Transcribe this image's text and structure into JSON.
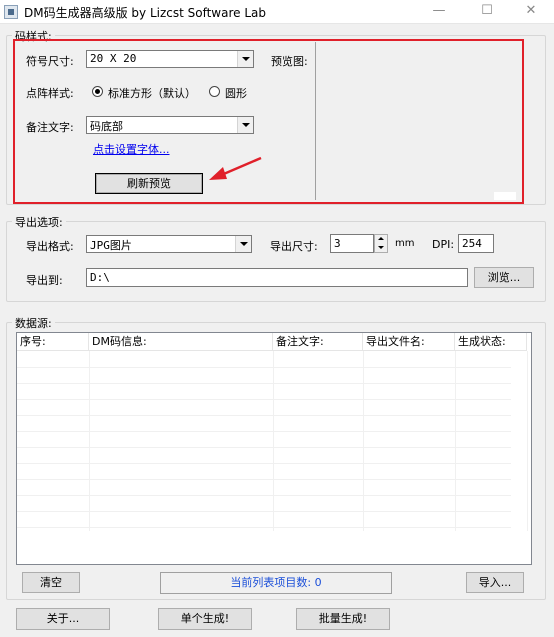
{
  "window": {
    "title": "DM码生成器高级版   by Lizcst Software Lab",
    "minimize_glyph": "—",
    "maximize_glyph": "☐",
    "close_glyph": "✕"
  },
  "style_group": {
    "label": "码样式:",
    "symbol_size_label": "符号尺寸:",
    "symbol_size_value": "20 X 20",
    "dot_style_label": "点阵样式:",
    "dot_style_options": [
      "标准方形（默认）",
      "圆形"
    ],
    "dot_style_selected": "标准方形（默认）",
    "note_label": "备注文字:",
    "note_value": "码底部",
    "font_link": "点击设置字体...",
    "preview_label": "预览图:",
    "refresh_button": "刷新预览"
  },
  "export_group": {
    "label": "导出选项:",
    "format_label": "导出格式:",
    "format_value": "JPG图片",
    "size_label": "导出尺寸:",
    "size_value": "3",
    "size_unit": "mm",
    "dpi_label": "DPI:",
    "dpi_value": "254",
    "path_label": "导出到:",
    "path_value": "D:\\",
    "browse_button": "浏览..."
  },
  "data_group": {
    "label": "数据源:",
    "columns": [
      "序号:",
      "DM码信息:",
      "备注文字:",
      "导出文件名:",
      "生成状态:"
    ],
    "rows": [],
    "clear_button": "清空",
    "count_text": "当前列表项目数: 0",
    "import_button": "导入..."
  },
  "bottom": {
    "about_button": "关于...",
    "single_button": "单个生成!",
    "batch_button": "批量生成!"
  },
  "colors": {
    "highlight": "#e0202a",
    "link": "#0000ee",
    "status_text": "#1a4ed8"
  }
}
